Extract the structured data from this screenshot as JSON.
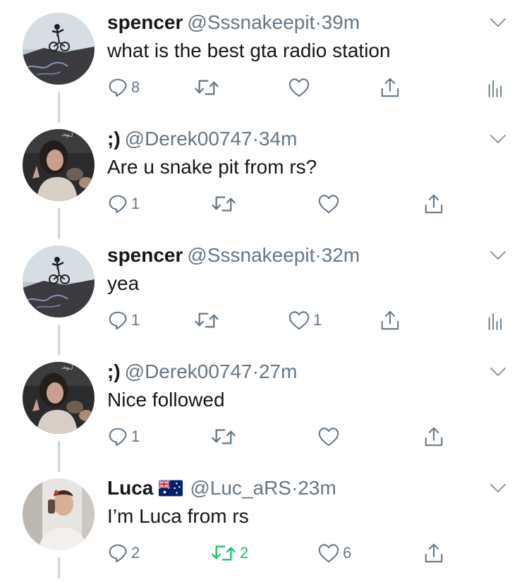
{
  "colors": {
    "text": "#14171a",
    "muted": "#657786",
    "icon": "#657786",
    "retweet_active": "#17bf63",
    "thread_line": "#ccd6dd"
  },
  "tweets": [
    {
      "name": "spencer",
      "handle": "@Sssnakeepit",
      "dot": "·",
      "time": "39m",
      "text": "what is the best gta radio station",
      "replies": "8",
      "retweets": "",
      "likes": "",
      "avatar": "bmx-rider-avatar",
      "has_analytics": true
    },
    {
      "name": ";)",
      "handle": "@Derek00747",
      "dot": "·",
      "time": "34m",
      "text": "Are u snake pit from rs?",
      "replies": "1",
      "retweets": "",
      "likes": "",
      "avatar": "selfie-avatar",
      "has_analytics": false
    },
    {
      "name": "spencer",
      "handle": "@Sssnakeepit",
      "dot": "·",
      "time": "32m",
      "text": "yea",
      "replies": "1",
      "retweets": "",
      "likes": "1",
      "avatar": "bmx-rider-avatar",
      "has_analytics": true
    },
    {
      "name": ";)",
      "handle": "@Derek00747",
      "dot": "·",
      "time": "27m",
      "text": "Nice followed",
      "replies": "1",
      "retweets": "",
      "likes": "",
      "avatar": "selfie-avatar",
      "has_analytics": false
    },
    {
      "name": "Luca",
      "flag": "australia-flag-emoji",
      "handle": "@Luc_aRS",
      "dot": "·",
      "time": "23m",
      "text": "I’m Luca from rs",
      "replies": "2",
      "retweets": "2",
      "retweeted": true,
      "likes": "6",
      "avatar": "phone-call-avatar",
      "has_analytics": false
    }
  ]
}
